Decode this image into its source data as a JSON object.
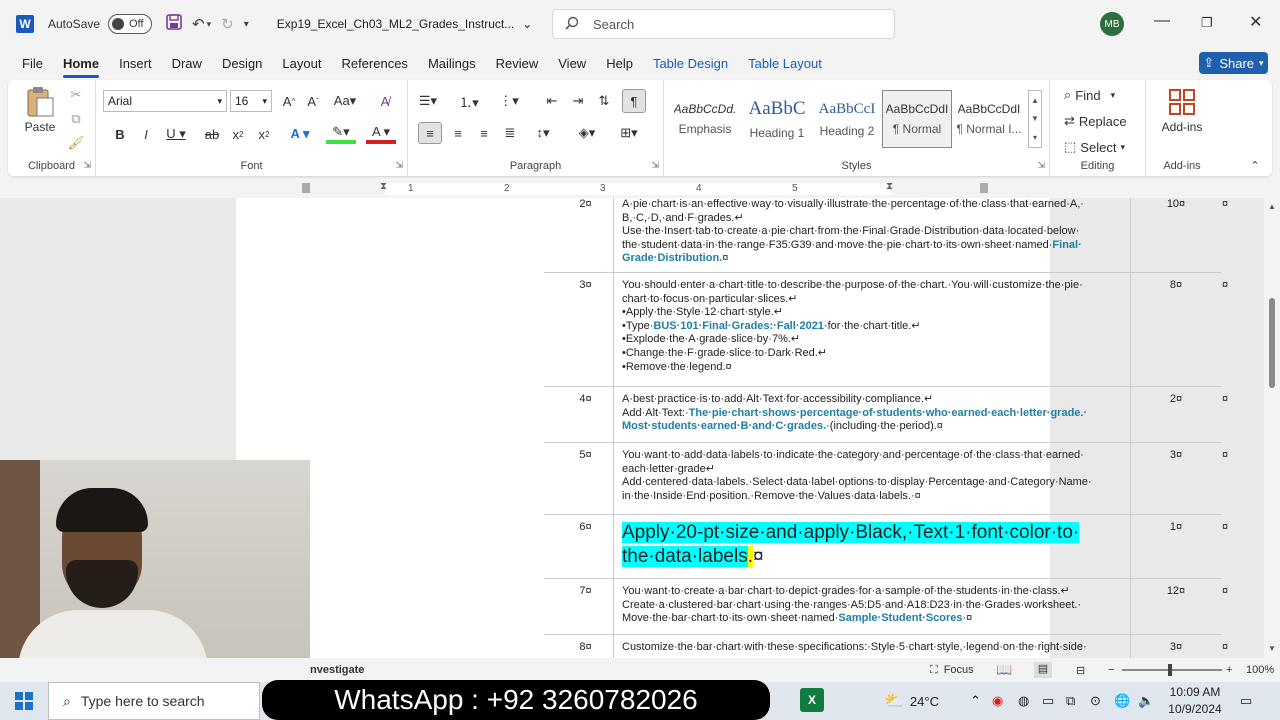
{
  "titlebar": {
    "autosave_label": "AutoSave",
    "autosave_state": "Off",
    "doc_title": "Exp19_Excel_Ch03_ML2_Grades_Instruct...",
    "search_placeholder": "Search",
    "avatar_initials": "MB"
  },
  "menu": {
    "tabs": [
      "File",
      "Home",
      "Insert",
      "Draw",
      "Design",
      "Layout",
      "References",
      "Mailings",
      "Review",
      "View",
      "Help"
    ],
    "contextual_tabs": [
      "Table Design",
      "Table Layout"
    ],
    "active": "Home",
    "share_label": "Share"
  },
  "ribbon": {
    "clipboard": {
      "paste_label": "Paste",
      "group_label": "Clipboard"
    },
    "font": {
      "family": "Arial",
      "size": "16",
      "group_label": "Font"
    },
    "paragraph": {
      "group_label": "Paragraph"
    },
    "styles": {
      "group_label": "Styles",
      "items": [
        {
          "preview": "AaBbCcDd.",
          "name": "Emphasis"
        },
        {
          "preview": "AaBbC",
          "name": "Heading 1"
        },
        {
          "preview": "AaBbCcI",
          "name": "Heading 2"
        },
        {
          "preview": "AaBbCcDdI",
          "name": "¶ Normal"
        },
        {
          "preview": "AaBbCcDdI",
          "name": "¶ Normal I..."
        }
      ]
    },
    "editing": {
      "find": "Find",
      "replace": "Replace",
      "select": "Select",
      "group_label": "Editing"
    },
    "addins": {
      "label": "Add-ins",
      "group_label": "Add-ins"
    }
  },
  "ruler": {
    "numbers": [
      "1",
      "2",
      "3",
      "4",
      "5"
    ]
  },
  "table": {
    "rows": [
      {
        "num": "2¤",
        "pts": "10¤",
        "lines": [
          [
            {
              "t": "A·pie·chart·is·an·effective·way·to·visually·illustrate·the·percentage·of·the·class·that·earned·A,·"
            }
          ],
          [
            {
              "t": "B,·C,·D,·and·F·grades.↵"
            }
          ],
          [
            {
              "t": "Use·the·Insert·tab·to·create·a·pie·chart·from·the·Final·Grade·Distribution·data·located·below·"
            }
          ],
          [
            {
              "t": "the·student·data·in·the·range·F35:G39·and·move·the·pie·chart·to·its·own·sheet·named·"
            },
            {
              "t": "Final·",
              "h": true
            }
          ],
          [
            {
              "t": "Grade·Distribution.",
              "h": true
            },
            {
              "t": "¤"
            }
          ]
        ]
      },
      {
        "num": "3¤",
        "pts": "8¤",
        "lines": [
          [
            {
              "t": "You·should·enter·a·chart·title·to·describe·the·purpose·of·the·chart.·You·will·customize·the·pie·"
            }
          ],
          [
            {
              "t": "chart·to·focus·on·particular·slices.↵"
            }
          ],
          [
            {
              "t": "•Apply·the·Style·12·chart·style.↵"
            }
          ],
          [
            {
              "t": "•Type·"
            },
            {
              "t": "BUS·101·Final·Grades:·Fall·2021",
              "h": true
            },
            {
              "t": "·for·the·chart·title.↵"
            }
          ],
          [
            {
              "t": "•Explode·the·A·grade·slice·by·7%.↵"
            }
          ],
          [
            {
              "t": "•Change·the·F·grade·slice·to·Dark·Red.↵"
            }
          ],
          [
            {
              "t": "•Remove·the·legend.¤"
            }
          ]
        ]
      },
      {
        "num": "4¤",
        "pts": "2¤",
        "lines": [
          [
            {
              "t": "A·best·practice·is·to·add·Alt·Text·for·accessibility·compliance.↵"
            }
          ],
          [
            {
              "t": "Add·Alt·Text:·"
            },
            {
              "t": "The·pie·chart·shows·percentage·of·students·who·earned·each·letter·grade.·",
              "h": true
            }
          ],
          [
            {
              "t": "Most·students·earned·B·and·C·grades.",
              "h": true
            },
            {
              "t": "·(including·the·period).¤"
            }
          ]
        ]
      },
      {
        "num": "5¤",
        "pts": "3¤",
        "lines": [
          [
            {
              "t": "You·want·to·add·data·labels·to·indicate·the·category·and·percentage·of·the·class·that·earned·"
            }
          ],
          [
            {
              "t": "each·letter·grade↵"
            }
          ],
          [
            {
              "t": "Add·centered·data·labels.·Select·data·label·options·to·display·Percentage·and·Category·Name·"
            }
          ],
          [
            {
              "t": "in·the·Inside·End·position.·Remove·the·Values·data·labels.·¤"
            }
          ]
        ]
      },
      {
        "num": "6¤",
        "pts": "1¤",
        "big": true,
        "lines": [
          [
            {
              "t": "Apply·20-pt·size·and·apply·Black,·Text·1·font·color·to·",
              "b": true
            }
          ],
          [
            {
              "t": "the·data·labels",
              "b": true
            },
            {
              "t": ".",
              "y": true
            },
            {
              "t": "¤"
            }
          ]
        ]
      },
      {
        "num": "7¤",
        "pts": "12¤",
        "lines": [
          [
            {
              "t": "You·want·to·create·a·bar·chart·to·depict·grades·for·a·sample·of·the·students·in·the·class.↵"
            }
          ],
          [
            {
              "t": "Create·a·clustered·bar·chart·using·the·ranges·A5:D5·and·A18:D23·in·the·Grades·worksheet.·"
            }
          ],
          [
            {
              "t": "Move·the·bar·chart·to·its·own·sheet·named·"
            },
            {
              "t": "Sample·Student·Scores",
              "h": true
            },
            {
              "t": "·¤"
            }
          ]
        ]
      },
      {
        "num": "8¤",
        "pts": "3¤",
        "lines": [
          [
            {
              "t": "Customize·the·bar·chart·with·these·specifications:·Style·5·chart·style,·legend·on·the·right·side·"
            }
          ]
        ]
      }
    ],
    "endmark": "¤"
  },
  "statusbar": {
    "left": "nvestigate",
    "focus": "Focus",
    "zoom": "100%"
  },
  "taskbar": {
    "search_placeholder": "Type here to search",
    "banner": "WhatsApp : +92 3260782026",
    "temperature": "24°C",
    "time": "10:09 AM",
    "date": "10/9/2024"
  },
  "colors": {
    "accent": "#185abd",
    "highlight_cyan": "#00ffff",
    "highlight_yellow": "#ffff00",
    "link_teal": "#1f7fa6"
  }
}
